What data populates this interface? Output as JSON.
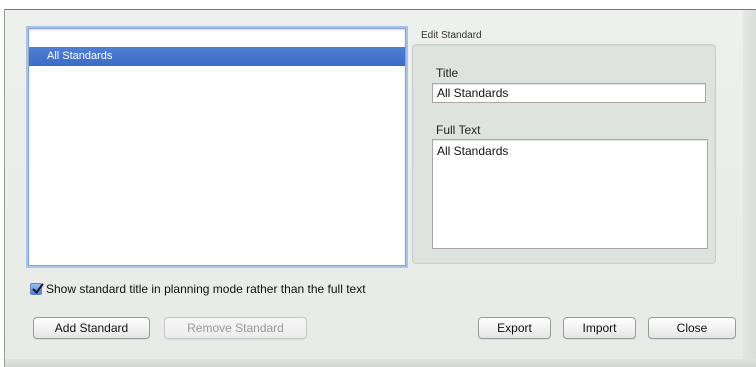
{
  "dialog": {
    "list": {
      "items": [
        {
          "label": "All Standards",
          "selected": true
        }
      ]
    },
    "edit_group": {
      "caption": "Edit Standard",
      "title_label": "Title",
      "title_value": "All Standards",
      "full_text_label": "Full Text",
      "full_text_value": "All Standards"
    },
    "options": {
      "show_title_label": "Show standard title in planning mode rather than the full text",
      "show_title_checked": true
    },
    "buttons": {
      "add_label": "Add Standard",
      "remove_label": "Remove Standard",
      "export_label": "Export",
      "import_label": "Import",
      "close_label": "Close"
    }
  },
  "colors": {
    "selection": "#3d6cc6",
    "focus_ring": "#a8c3ea",
    "panel_bg": "#dfe3df",
    "sheet_bg": "#e7eae6"
  }
}
